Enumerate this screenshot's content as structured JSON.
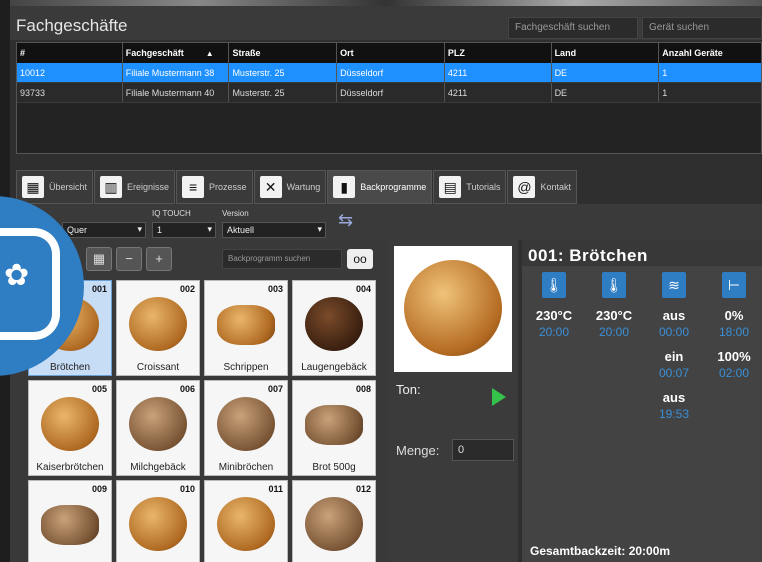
{
  "header": {
    "title": "Fachgeschäfte",
    "search_store_placeholder": "Fachgeschäft suchen",
    "search_device_placeholder": "Gerät suchen"
  },
  "table": {
    "columns": [
      "#",
      "Fachgeschäft",
      "Straße",
      "Ort",
      "PLZ",
      "Land",
      "Anzahl Geräte"
    ],
    "rows": [
      [
        "10012",
        "Filiale Mustermann 38",
        "Musterstr. 25",
        "Düsseldorf",
        "4211",
        "DE",
        "1"
      ],
      [
        "93733",
        "Filiale Mustermann 40",
        "Musterstr. 25",
        "Düsseldorf",
        "4211",
        "DE",
        "1"
      ]
    ],
    "selected_row": 0
  },
  "tabs": [
    {
      "label": "Übersicht",
      "icon": "calendar-icon"
    },
    {
      "label": "Ereignisse",
      "icon": "chart-icon"
    },
    {
      "label": "Prozesse",
      "icon": "document-icon"
    },
    {
      "label": "Wartung",
      "icon": "tools-icon"
    },
    {
      "label": "Backprogramme",
      "icon": "book-icon"
    },
    {
      "label": "Tutorials",
      "icon": "film-icon"
    },
    {
      "label": "Kontakt",
      "icon": "at-icon"
    }
  ],
  "active_tab": "Backprogramme",
  "toolbar": {
    "orientation_value": "Quer",
    "iq_touch_label": "IQ TOUCH",
    "iq_touch_value": "1",
    "version_label": "Version",
    "version_value": "Aktuell"
  },
  "backprogramme": {
    "search_placeholder": "Backprogramm suchen",
    "items": [
      {
        "num": "001",
        "name": "Brötchen"
      },
      {
        "num": "002",
        "name": "Croissant"
      },
      {
        "num": "003",
        "name": "Schrippen"
      },
      {
        "num": "004",
        "name": "Laugengebäck"
      },
      {
        "num": "005",
        "name": "Kaiserbrötchen"
      },
      {
        "num": "006",
        "name": "Milchgebäck"
      },
      {
        "num": "007",
        "name": "Minibröchen"
      },
      {
        "num": "008",
        "name": "Brot 500g"
      },
      {
        "num": "009",
        "name": ""
      },
      {
        "num": "010",
        "name": ""
      },
      {
        "num": "011",
        "name": ""
      },
      {
        "num": "012",
        "name": ""
      }
    ]
  },
  "detail": {
    "ton_label": "Ton:",
    "menge_label": "Menge:",
    "menge_value": "0"
  },
  "program": {
    "title": "001: Brötchen",
    "columns": [
      {
        "icon": "thermometer-icon",
        "lines": [
          [
            "230°C",
            "20:00"
          ]
        ]
      },
      {
        "icon": "thermometer-icon",
        "lines": [
          [
            "230°C",
            "20:00"
          ]
        ]
      },
      {
        "icon": "steam-icon",
        "lines": [
          [
            "aus",
            "00:00"
          ],
          [
            "ein",
            "00:07"
          ],
          [
            "aus",
            "19:53"
          ]
        ]
      },
      {
        "icon": "vent-icon",
        "lines": [
          [
            "0%",
            "18:00"
          ],
          [
            "100%",
            "02:00"
          ]
        ]
      }
    ],
    "total": "Gesamtbackzeit: 20:00m"
  },
  "colors": {
    "accent_blue": "#2f7dc2",
    "selected_row": "#1e90ff",
    "play_green": "#35c24a"
  }
}
